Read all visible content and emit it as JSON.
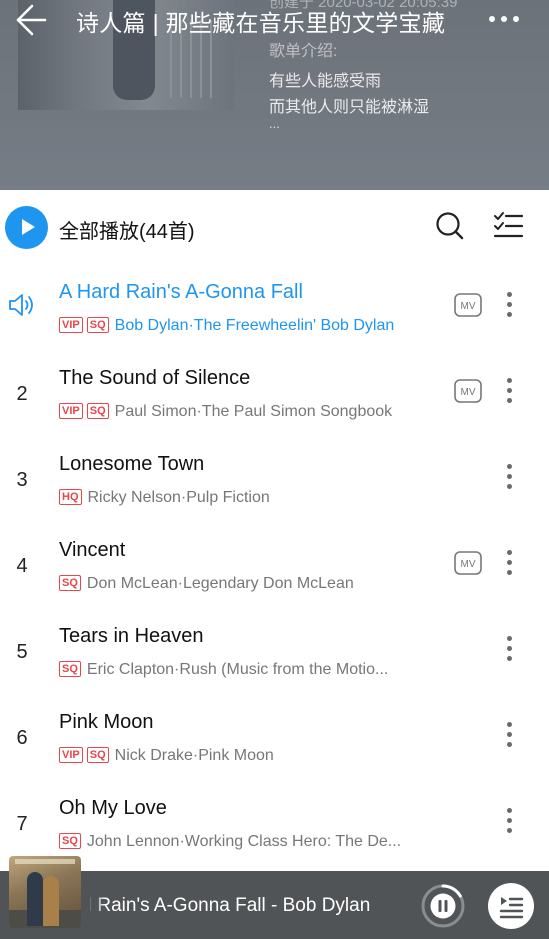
{
  "header": {
    "title": "诗人篇 | 那些藏在音乐里的文学宝藏",
    "creator_line": "创建于 2020-03-02 20:05:39",
    "desc_label": "歌单介绍:",
    "desc_line1": "有些人能感受雨",
    "desc_line2": "而其他人则只能被淋湿",
    "desc_more": "..."
  },
  "toolbar": {
    "play_all_label": "全部播放(44首)",
    "accent_color": "#1e95ef"
  },
  "songs": [
    {
      "number": "",
      "title": "A Hard Rain's A-Gonna Fall",
      "badges": [
        "VIP",
        "SQ"
      ],
      "artist_album": "Bob Dylan·The Freewheelin' Bob Dylan",
      "has_mv": true,
      "playing": true,
      "mv_label": "MV"
    },
    {
      "number": "2",
      "title": "The Sound of Silence",
      "badges": [
        "VIP",
        "SQ"
      ],
      "artist_album": "Paul Simon·The Paul Simon Songbook",
      "has_mv": true,
      "playing": false,
      "mv_label": "MV"
    },
    {
      "number": "3",
      "title": "Lonesome Town",
      "badges": [
        "HQ"
      ],
      "artist_album": "Ricky Nelson·Pulp Fiction",
      "has_mv": false,
      "playing": false,
      "mv_label": ""
    },
    {
      "number": "4",
      "title": "Vincent",
      "badges": [
        "SQ"
      ],
      "artist_album": "Don McLean·Legendary Don McLean",
      "has_mv": true,
      "playing": false,
      "mv_label": "MV"
    },
    {
      "number": "5",
      "title": "Tears in Heaven",
      "badges": [
        "SQ"
      ],
      "artist_album": "Eric Clapton·Rush (Music from the Motio...",
      "has_mv": false,
      "playing": false,
      "mv_label": ""
    },
    {
      "number": "6",
      "title": "Pink Moon",
      "badges": [
        "VIP",
        "SQ"
      ],
      "artist_album": "Nick Drake·Pink Moon",
      "has_mv": false,
      "playing": false,
      "mv_label": ""
    },
    {
      "number": "7",
      "title": "Oh My Love",
      "badges": [
        "SQ"
      ],
      "artist_album": "John Lennon·Working Class Hero: The De...",
      "has_mv": false,
      "playing": false,
      "mv_label": ""
    }
  ],
  "mini_player": {
    "now_playing_text": "A Hard Rain's A-Gonna Fall  -  Bob Dylan",
    "icons": [
      "pause-icon",
      "playlist-icon"
    ]
  },
  "icons": {
    "back": "back-arrow-icon",
    "more": "more-dots-icon",
    "play": "play-icon",
    "search": "search-icon",
    "multiselect": "multiselect-list-icon",
    "speaker": "speaker-playing-icon",
    "mv": "mv-icon",
    "song_menu": "vertical-dots-icon"
  }
}
